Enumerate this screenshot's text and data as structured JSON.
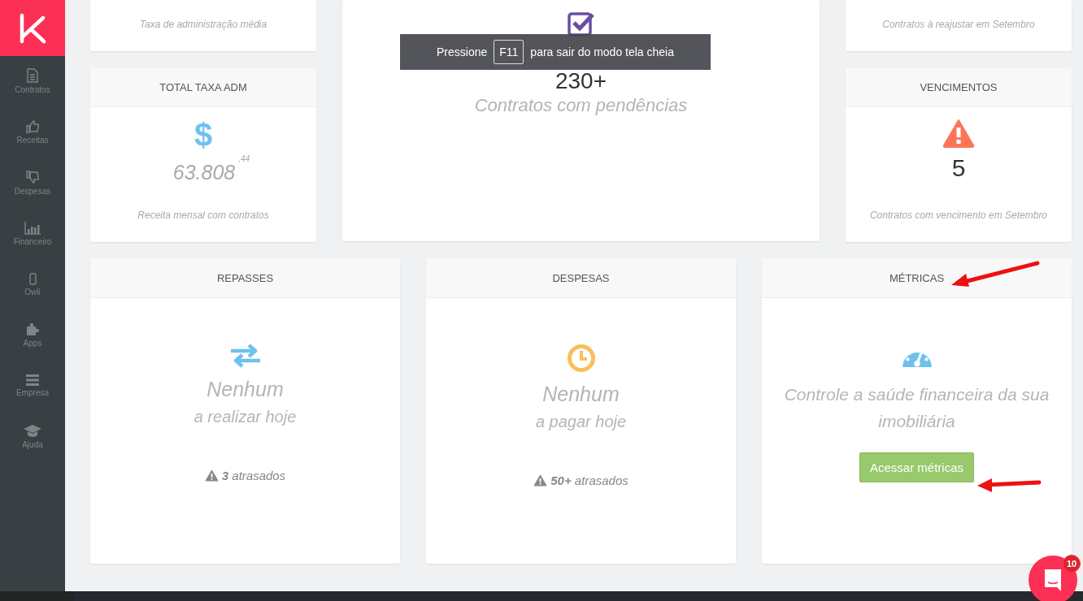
{
  "sidebar": {
    "items": [
      {
        "label": "Contratos"
      },
      {
        "label": "Receitas"
      },
      {
        "label": "Despesas"
      },
      {
        "label": "Financeiro"
      },
      {
        "label": "Owli"
      },
      {
        "label": "Apps"
      },
      {
        "label": "Empresa"
      },
      {
        "label": "Ajuda"
      }
    ]
  },
  "top_left": [
    {
      "kind": "caption",
      "caption": "Taxa de administração média"
    },
    {
      "kind": "stat",
      "title": "TOTAL TAXA ADM",
      "glyph": "$",
      "value": "63.808",
      "cents": ",44",
      "caption": "Receita mensal com contratos"
    }
  ],
  "top_middle": {
    "value": "230+",
    "caption": "Contratos com pendências"
  },
  "top_right": [
    {
      "kind": "caption",
      "caption": "Contratos à reajustar em Setembro"
    },
    {
      "kind": "stat",
      "title": "VENCIMENTOS",
      "value": "5",
      "caption": "Contratos com vencimento em Setembro"
    }
  ],
  "bottom_cards": [
    {
      "kind": "today",
      "title": "REPASSES",
      "headline": "Nenhum",
      "subline": "a realizar hoje",
      "overdue": "**3** atrasados"
    },
    {
      "kind": "today",
      "title": "DESPESAS",
      "headline": "Nenhum",
      "subline": "a pagar hoje",
      "overdue": "**50+** atrasados"
    },
    {
      "kind": "promo",
      "title": "MÉTRICAS",
      "text": "Controle a saúde financeira da sua imobiliária",
      "button": "Acessar métricas"
    }
  ],
  "fullscreen_notice": {
    "before": "Pressione",
    "key": "F11",
    "after": "para sair do modo tela cheia"
  },
  "chat": {
    "badge": "10"
  }
}
